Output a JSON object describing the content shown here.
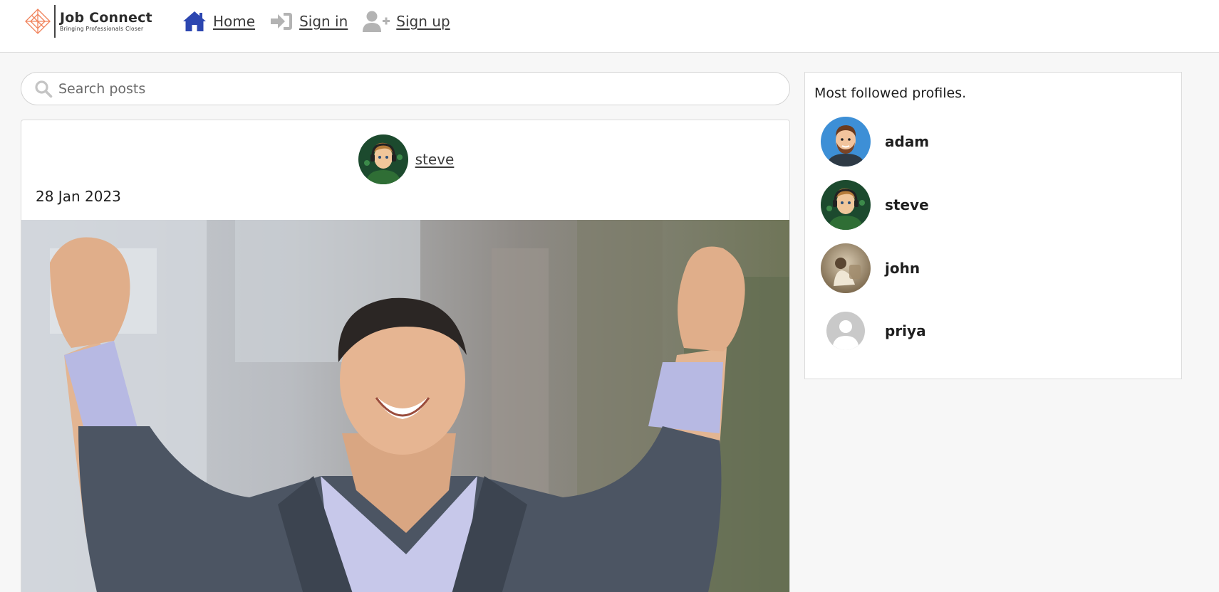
{
  "navbar": {
    "logo_title": "Job Connect",
    "logo_tagline": "Bringing Professionals Closer",
    "links": [
      {
        "label": "Home",
        "icon": "home-icon"
      },
      {
        "label": "Sign in",
        "icon": "sign-in-icon"
      },
      {
        "label": "Sign up",
        "icon": "user-plus-icon"
      }
    ]
  },
  "search": {
    "placeholder": "Search posts",
    "value": "",
    "icon": "search-icon"
  },
  "post": {
    "author": "steve",
    "date": "28 Jan 2023",
    "image": "celebrating-businessman-photo"
  },
  "sidebar": {
    "title": "Most followed profiles.",
    "profiles": [
      {
        "name": "adam",
        "avatar": "cartoon-bearded-man-avatar"
      },
      {
        "name": "steve",
        "avatar": "cartoon-gamer-avatar"
      },
      {
        "name": "john",
        "avatar": "photo-avatar"
      },
      {
        "name": "priya",
        "avatar": "default-user-avatar"
      }
    ]
  },
  "colors": {
    "accent_home_icon": "#2c46b0",
    "muted_icon": "#b3b3b3",
    "logo_orange": "#f0825a",
    "page_background": "#f7f7f7"
  }
}
